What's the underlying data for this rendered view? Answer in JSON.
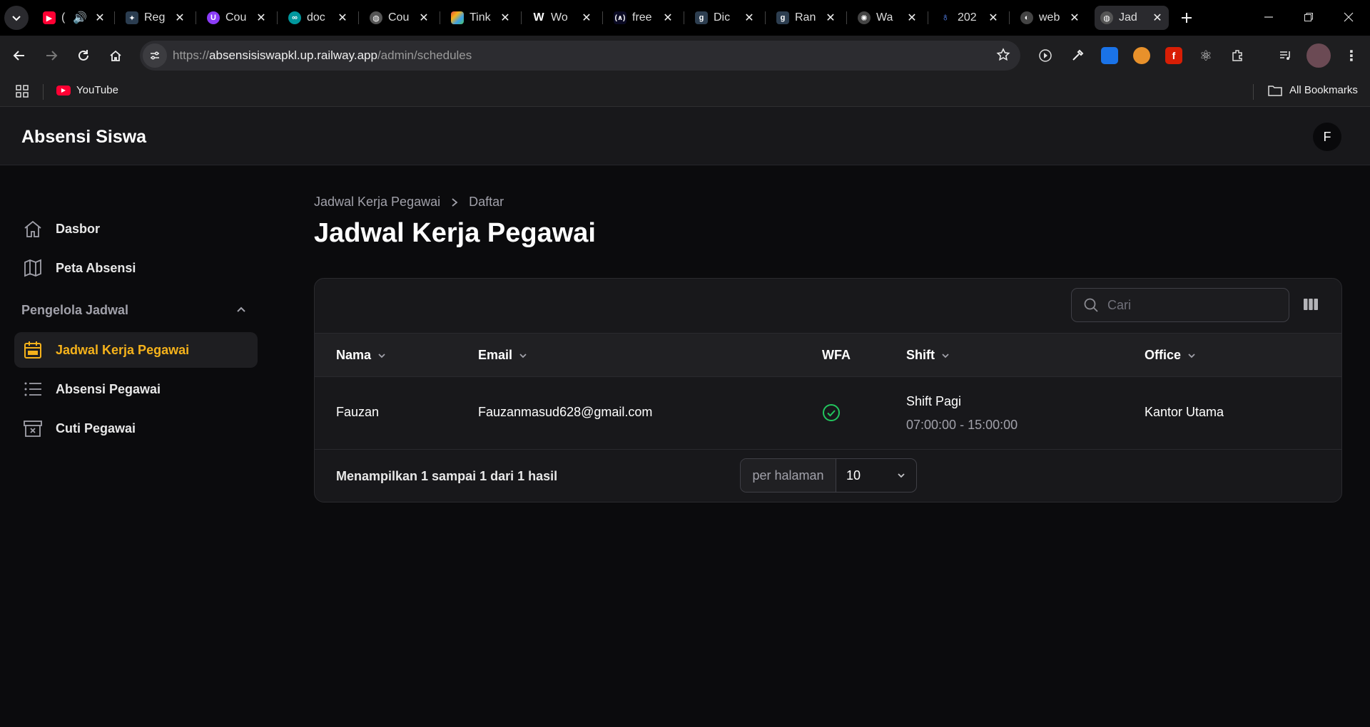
{
  "browser": {
    "tabs": [
      {
        "title": "(",
        "favicon": "youtube-icon",
        "color": "#ff0033"
      },
      {
        "title": "Reg",
        "favicon": "spark-icon",
        "color": "#2b3d50"
      },
      {
        "title": "Cou",
        "favicon": "udemy-icon",
        "color": "#8b3cf7"
      },
      {
        "title": "doc",
        "favicon": "arduino-icon",
        "color": "#00979d"
      },
      {
        "title": "Cou",
        "favicon": "globe-icon",
        "color": "#555555"
      },
      {
        "title": "Tink",
        "favicon": "tinkercad-icon",
        "color": "#e84a3c"
      },
      {
        "title": "Wo",
        "favicon": "wikipedia-icon",
        "color": "#000000"
      },
      {
        "title": "free",
        "favicon": "freecodecamp-icon",
        "color": "#0a0a23"
      },
      {
        "title": "Dic",
        "favicon": "dicoding-icon",
        "color": "#2d3e50"
      },
      {
        "title": "Ran",
        "favicon": "dicoding-icon",
        "color": "#2d3e50"
      },
      {
        "title": "Wa",
        "favicon": "openai-icon",
        "color": "#444444"
      },
      {
        "title": "202",
        "favicon": "figure-icon",
        "color": "#1c2a4a"
      },
      {
        "title": "web",
        "favicon": "web-icon",
        "color": "#444444"
      },
      {
        "title": "Jad",
        "favicon": "globe-icon",
        "color": "#555555"
      }
    ],
    "url_scheme": "https://",
    "url_host": "absensisiswapkl.up.railway.app",
    "url_path": "/admin/schedules",
    "bookmarks": {
      "youtube": "YouTube",
      "all": "All Bookmarks"
    }
  },
  "app": {
    "brand": "Absensi Siswa",
    "avatar_initial": "F",
    "nav": {
      "dashboard": "Dasbor",
      "map": "Peta Absensi",
      "group_label": "Pengelola Jadwal",
      "schedules": "Jadwal Kerja Pegawai",
      "attendance": "Absensi Pegawai",
      "leave": "Cuti Pegawai"
    },
    "accent_color": "#f5b21b"
  },
  "page": {
    "breadcrumb": [
      "Jadwal Kerja Pegawai",
      "Daftar"
    ],
    "title": "Jadwal Kerja Pegawai",
    "search_placeholder": "Cari"
  },
  "table": {
    "columns": {
      "name": "Nama",
      "email": "Email",
      "wfa": "WFA",
      "shift": "Shift",
      "office": "Office"
    },
    "rows": [
      {
        "name": "Fauzan",
        "email": "Fauzanmasud628@gmail.com",
        "wfa": true,
        "shift": "Shift Pagi",
        "shift_time": "07:00:00 - 15:00:00",
        "office": "Kantor Utama"
      }
    ],
    "summary": "Menampilkan 1 sampai 1 dari 1 hasil",
    "per_page_label": "per halaman",
    "per_page_value": "10"
  }
}
